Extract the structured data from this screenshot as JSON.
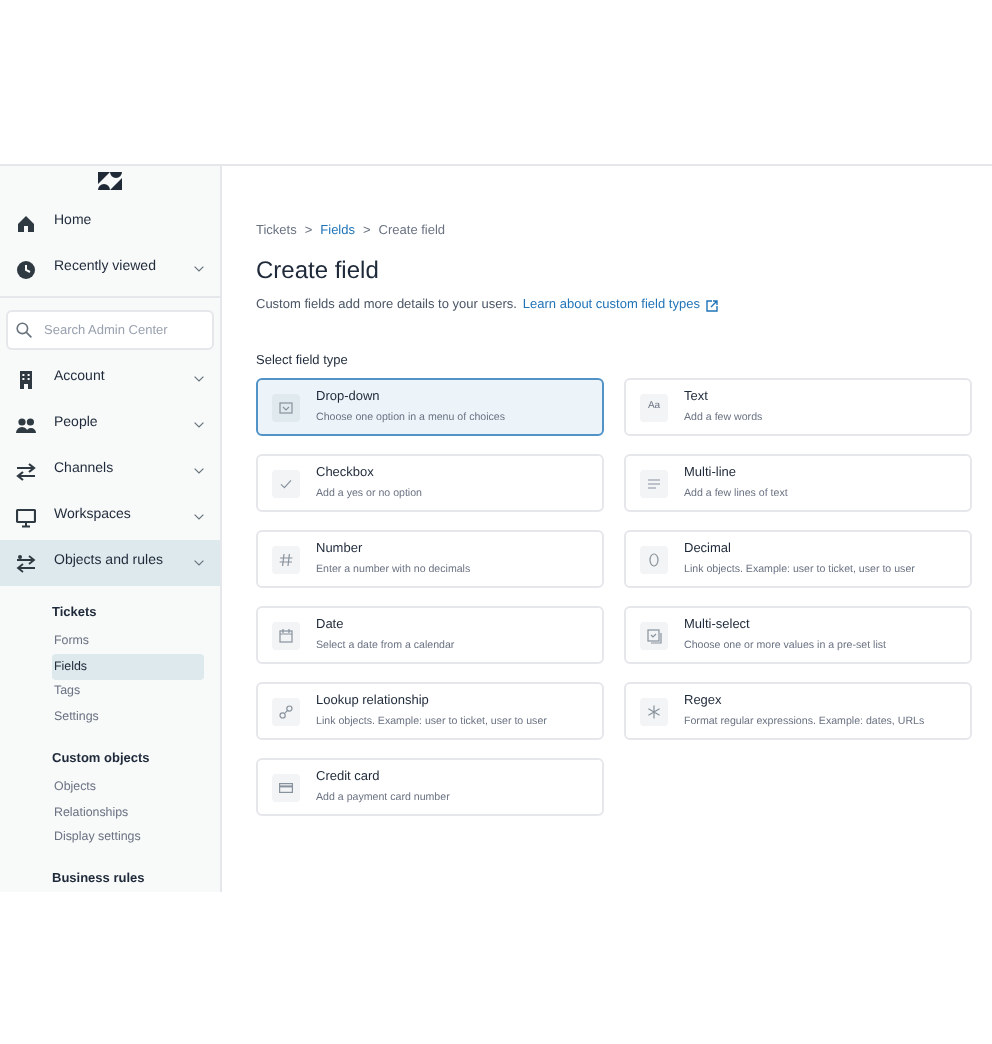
{
  "nav": [
    {
      "label": "Home",
      "chevron": false,
      "selected": false
    },
    {
      "label": "Recently viewed",
      "chevron": true,
      "selected": false
    },
    {
      "label": "Account",
      "chevron": true,
      "selected": false
    },
    {
      "label": "People",
      "chevron": true,
      "selected": false
    },
    {
      "label": "Channels",
      "chevron": true,
      "selected": false
    },
    {
      "label": "Workspaces",
      "chevron": true,
      "selected": false
    },
    {
      "label": "Objects and rules",
      "chevron": true,
      "selected": true
    }
  ],
  "search": {
    "placeholder": "Search Admin Center"
  },
  "sections": [
    {
      "title": "Tickets",
      "links": [
        {
          "label": "Forms",
          "selected": false
        },
        {
          "label": "Fields",
          "selected": true
        },
        {
          "label": "Tags",
          "selected": false
        },
        {
          "label": "Settings",
          "selected": false
        }
      ]
    },
    {
      "title": "Custom objects",
      "links": [
        {
          "label": "Objects",
          "selected": false
        },
        {
          "label": "Relationships",
          "selected": false
        },
        {
          "label": "Display settings",
          "selected": false
        }
      ]
    },
    {
      "title": "Business rules"
    }
  ],
  "breadcrumb": [
    {
      "label": "Tickets",
      "link": false
    },
    {
      "label": "Fields",
      "link": true
    },
    {
      "label": "Create field",
      "link": false
    }
  ],
  "breadcrumb_separator": ">",
  "title": "Create field",
  "description": "Custom fields add more details to your users.",
  "learn_link": "Learn about custom field types",
  "section_label": "Select field type",
  "field_types": [
    {
      "name": "Drop-down",
      "desc": "Choose one option in a menu of choices",
      "selected": true
    },
    {
      "name": "Text",
      "desc": "Add a few words",
      "selected": false,
      "icon_text": "Aa"
    },
    {
      "name": "Checkbox",
      "desc": "Add a yes or no option",
      "selected": false
    },
    {
      "name": "Multi-line",
      "desc": "Add a few lines of text",
      "selected": false
    },
    {
      "name": "Number",
      "desc": "Enter a number with no decimals",
      "selected": false
    },
    {
      "name": "Decimal",
      "desc": "Link objects. Example: user to ticket, user to user",
      "selected": false
    },
    {
      "name": "Date",
      "desc": "Select a date from a calendar",
      "selected": false
    },
    {
      "name": "Multi-select",
      "desc": "Choose one or more values in a pre-set list",
      "selected": false
    },
    {
      "name": "Lookup relationship",
      "desc": "Link objects. Example: user to ticket, user to user",
      "selected": false
    },
    {
      "name": "Regex",
      "desc": "Format regular expressions. Example: dates, URLs",
      "selected": false
    },
    {
      "name": "Credit card",
      "desc": "Add a payment card number",
      "selected": false
    }
  ]
}
